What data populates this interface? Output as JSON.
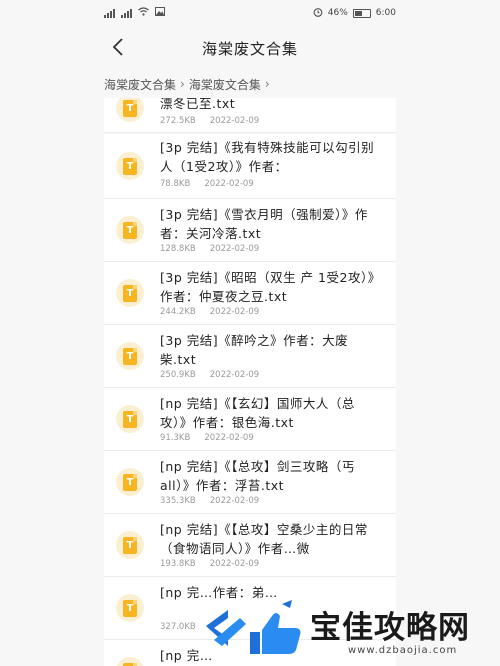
{
  "status": {
    "carrier_icons": "signal-icon",
    "battery": "46%",
    "time": "6:00"
  },
  "header": {
    "title": "海棠废文合集"
  },
  "breadcrumb": {
    "items": [
      "海棠废文合集",
      "海棠废文合集"
    ]
  },
  "files": [
    {
      "name": "漂冬已至.txt",
      "size": "272.5KB",
      "date": "2022-02-09"
    },
    {
      "name": "[3p 完结]《我有特殊技能可以勾引别人（1受2攻）》作者：",
      "size": "78.8KB",
      "date": "2022-02-09"
    },
    {
      "name": "[3p 完结]《雪衣月明（强制爱）》作者：关河冷落.txt",
      "size": "128.8KB",
      "date": "2022-02-09"
    },
    {
      "name": "[3p 完结]《昭昭（双生 产 1受2攻）》作者：仲夏夜之豆.txt",
      "size": "244.2KB",
      "date": "2022-02-09"
    },
    {
      "name": "[3p 完结]《醉吟之》作者：大废柴.txt",
      "size": "250.9KB",
      "date": "2022-02-09"
    },
    {
      "name": "[np 完结]《【玄幻】国师大人（总攻）》作者：银色海.txt",
      "size": "91.3KB",
      "date": "2022-02-09"
    },
    {
      "name": "[np 完结]《【总攻】剑三攻略（丐all）》作者：浮苔.txt",
      "size": "335.3KB",
      "date": "2022-02-09"
    },
    {
      "name": "[np 完结]《【总攻】空桑少主的日常（食物语同人）》作者…微",
      "size": "193.8KB",
      "date": "2022-02-09"
    },
    {
      "name": "[np 完…作者：弟…",
      "size": "327.0KB",
      "date": ""
    },
    {
      "name": "[np 完…",
      "size": "",
      "date": ""
    }
  ],
  "watermark": {
    "text": "宝佳攻略网",
    "url": "www.dzbaojia.com"
  },
  "colors": {
    "file_icon": "#f6b521",
    "file_icon_bg": "#fbefd2",
    "watermark_blue": "#1e6fd9"
  }
}
